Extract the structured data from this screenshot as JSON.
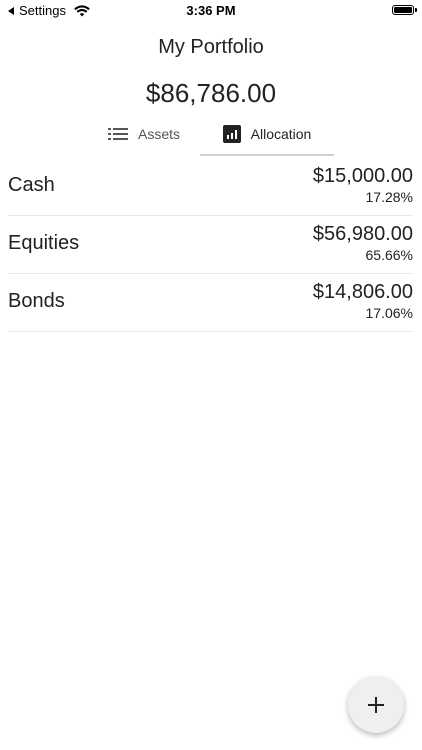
{
  "status_bar": {
    "back_label": "Settings",
    "time": "3:36 PM",
    "icons": [
      "back-caret-icon",
      "wifi-icon",
      "battery-icon"
    ]
  },
  "header": {
    "title": "My Portfolio",
    "total_value": "$86,786.00"
  },
  "tabs": [
    {
      "label": "Assets",
      "icon": "list-icon",
      "selected": false
    },
    {
      "label": "Allocation",
      "icon": "bar-chart-icon",
      "selected": true
    }
  ],
  "allocations": [
    {
      "name": "Cash",
      "amount": "$15,000.00",
      "percent": "17.28%"
    },
    {
      "name": "Equities",
      "amount": "$56,980.00",
      "percent": "65.66%"
    },
    {
      "name": "Bonds",
      "amount": "$14,806.00",
      "percent": "17.06%"
    }
  ],
  "fab": {
    "icon": "plus-icon"
  },
  "colors": {
    "text": "#222222",
    "divider": "#e8e8e8",
    "tab_indicator": "#cfcfcf",
    "fab_background": "#efefef"
  }
}
